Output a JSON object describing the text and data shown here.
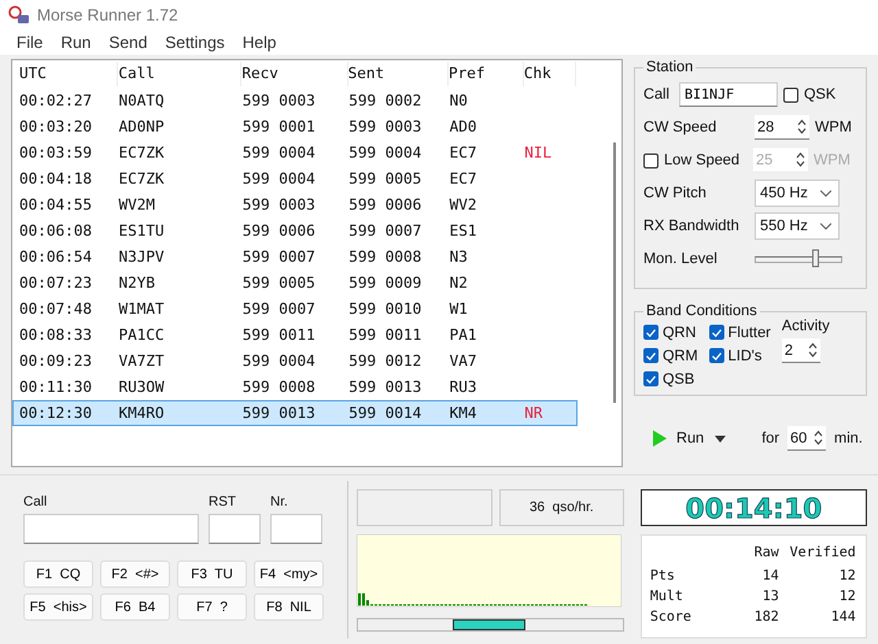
{
  "window": {
    "title": "Morse Runner 1.72"
  },
  "menu": [
    "File",
    "Run",
    "Send",
    "Settings",
    "Help"
  ],
  "log": {
    "columns": [
      "UTC",
      "Call",
      "Recv",
      "Sent",
      "Pref",
      "Chk"
    ],
    "rows": [
      {
        "cells": [
          "00:02:27",
          "N0ATQ",
          "599 0003",
          "599 0002",
          "N0",
          ""
        ],
        "selected": false
      },
      {
        "cells": [
          "00:03:20",
          "AD0NP",
          "599 0001",
          "599 0003",
          "AD0",
          ""
        ],
        "selected": false
      },
      {
        "cells": [
          "00:03:59",
          "EC7ZK",
          "599 0004",
          "599 0004",
          "EC7",
          "NIL"
        ],
        "selected": false
      },
      {
        "cells": [
          "00:04:18",
          "EC7ZK",
          "599 0004",
          "599 0005",
          "EC7",
          ""
        ],
        "selected": false
      },
      {
        "cells": [
          "00:04:55",
          "WV2M",
          "599 0003",
          "599 0006",
          "WV2",
          ""
        ],
        "selected": false
      },
      {
        "cells": [
          "00:06:08",
          "ES1TU",
          "599 0006",
          "599 0007",
          "ES1",
          ""
        ],
        "selected": false
      },
      {
        "cells": [
          "00:06:54",
          "N3JPV",
          "599 0007",
          "599 0008",
          "N3",
          ""
        ],
        "selected": false
      },
      {
        "cells": [
          "00:07:23",
          "N2YB",
          "599 0005",
          "599 0009",
          "N2",
          ""
        ],
        "selected": false
      },
      {
        "cells": [
          "00:07:48",
          "W1MAT",
          "599 0007",
          "599 0010",
          "W1",
          ""
        ],
        "selected": false
      },
      {
        "cells": [
          "00:08:33",
          "PA1CC",
          "599 0011",
          "599 0011",
          "PA1",
          ""
        ],
        "selected": false
      },
      {
        "cells": [
          "00:09:23",
          "VA7ZT",
          "599 0004",
          "599 0012",
          "VA7",
          ""
        ],
        "selected": false
      },
      {
        "cells": [
          "00:11:30",
          "RU3OW",
          "599 0008",
          "599 0013",
          "RU3",
          ""
        ],
        "selected": false
      },
      {
        "cells": [
          "00:12:30",
          "KM4RO",
          "599 0013",
          "599 0014",
          "KM4",
          "NR"
        ],
        "selected": true
      }
    ]
  },
  "station": {
    "title": "Station",
    "call_label": "Call",
    "call_value": "BI1NJF",
    "qsk": {
      "label": "QSK",
      "checked": false
    },
    "cw_speed_label": "CW Speed",
    "cw_speed": "28",
    "cw_unit": "WPM",
    "low_speed": {
      "label": "Low Speed",
      "checked": false,
      "value": "25",
      "unit": "WPM"
    },
    "pitch_label": "CW Pitch",
    "pitch": "450 Hz",
    "bandwidth_label": "RX Bandwidth",
    "bandwidth": "550 Hz",
    "mon_label": "Mon. Level",
    "mon_level": {
      "level": 0.72
    }
  },
  "band": {
    "title": "Band Conditions",
    "items": [
      {
        "label": "QRN",
        "checked": true
      },
      {
        "label": "QRM",
        "checked": true
      },
      {
        "label": "QSB",
        "checked": true
      },
      {
        "label": "Flutter",
        "checked": true
      },
      {
        "label": "LID's",
        "checked": true
      }
    ],
    "activity_label": "Activity",
    "activity": "2"
  },
  "run": {
    "label": "Run",
    "for_label": "for",
    "minutes": "60",
    "unit": "min."
  },
  "entry": {
    "call_label": "Call",
    "rst_label": "RST",
    "nr_label": "Nr.",
    "buttons": [
      "F1  CQ",
      "F2  <#>",
      "F3  TU",
      "F4  <my>",
      "F5  <his>",
      "F6  B4",
      "F7  ?",
      "F8  NIL"
    ]
  },
  "rate": "36  qso/hr.",
  "clock": "00:14:10",
  "score": {
    "columns": [
      "Raw",
      "Verified"
    ],
    "rows": [
      {
        "label": "Pts",
        "raw": "14",
        "verified": "12"
      },
      {
        "label": "Mult",
        "raw": "13",
        "verified": "12"
      },
      {
        "label": "Score",
        "raw": "182",
        "verified": "144"
      }
    ]
  }
}
